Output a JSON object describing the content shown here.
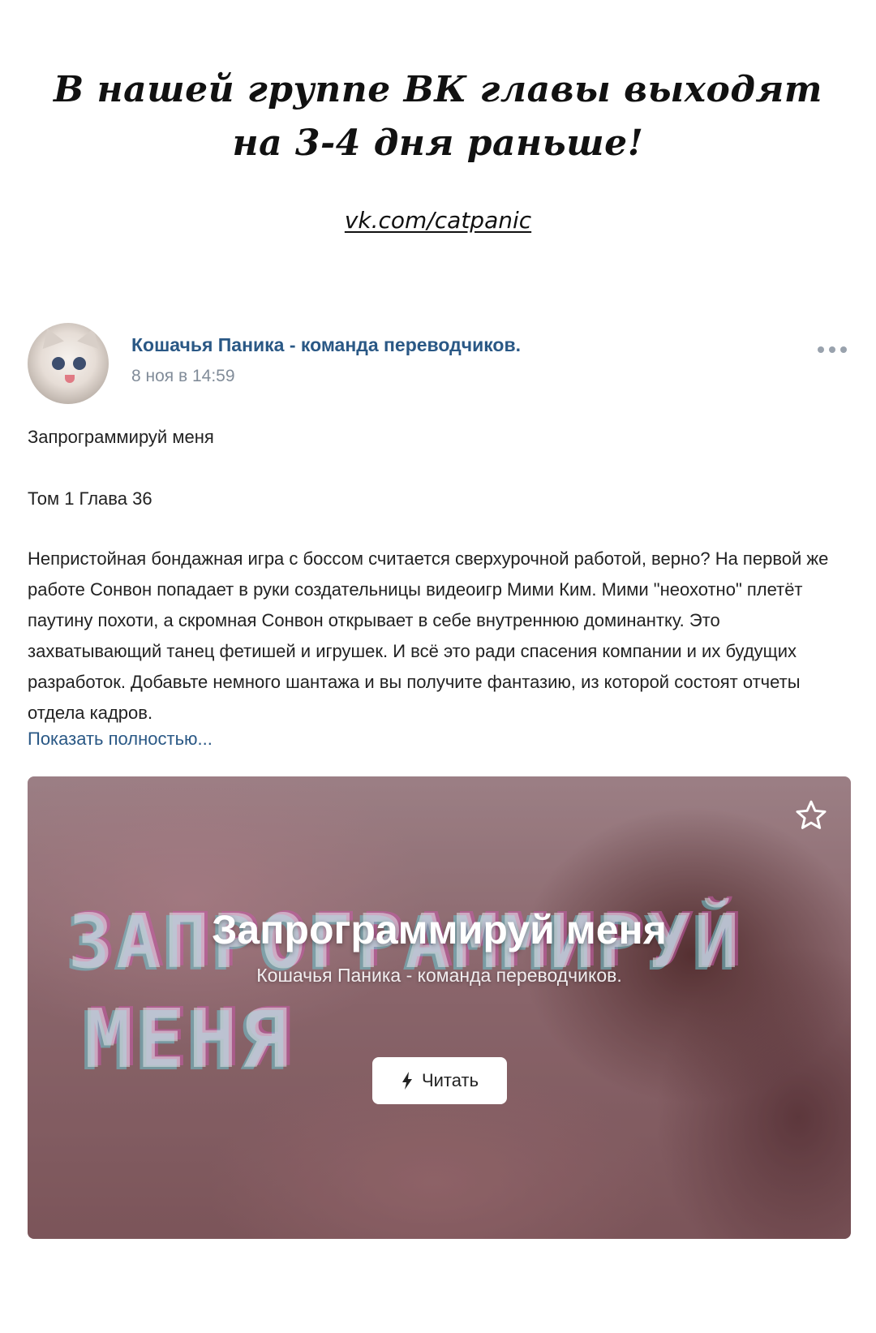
{
  "promo": {
    "line1": "В нашей группе ВК главы выходят",
    "line2": "на 3-4 дня раньше!",
    "link": "vk.com/catpanic"
  },
  "post": {
    "group_name": "Кошачья Паника - команда переводчиков.",
    "date": "8 ноя в 14:59",
    "title_line": "Запрограммируй меня",
    "chapter_line": "Том 1 Глава 36",
    "description": "Непристойная бондажная игра с боссом считается сверхурочной работой, верно? На первой же работе Сонвон попадает в руки создательницы видеоигр Мими Ким. Мими \"неохотно\" плетёт паутину похоти, а скромная Сонвон открывает в себе внутреннюю доминантку. Это захватывающий танец фетишей и игрушек. И всё это ради спасения компании и их будущих разработок. Добавьте немного шантажа и вы получите фантазию, из которой состоят отчеты отдела кадров.",
    "show_more": "Показать полностью..."
  },
  "card": {
    "bg_line1": "ЗАПРОГРАММИРУЙ",
    "bg_line2": "МЕНЯ",
    "title": "Запрограммируй меня",
    "subtitle": "Кошачья Паника - команда переводчиков.",
    "read_button": "Читать",
    "icons": {
      "favorite": "star-outline-icon",
      "read": "lightning-icon"
    }
  },
  "colors": {
    "link_blue": "#2a5885",
    "meta_gray": "#818c99",
    "text": "#222222"
  }
}
